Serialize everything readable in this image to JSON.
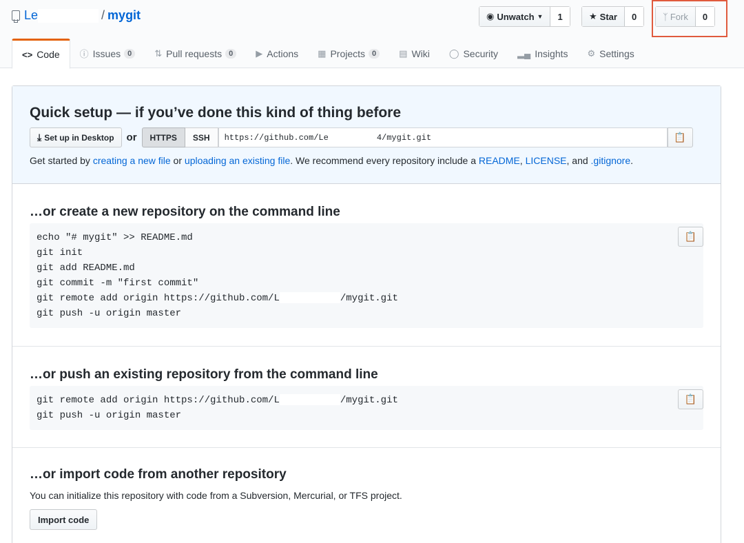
{
  "header": {
    "owner": "Le",
    "slash": "/",
    "repo": "mygit",
    "unwatch": {
      "label": "Unwatch",
      "count": "1"
    },
    "star": {
      "label": "Star",
      "count": "0"
    },
    "fork": {
      "label": "Fork",
      "count": "0"
    }
  },
  "tabs": [
    {
      "label": "Code"
    },
    {
      "label": "Issues",
      "count": "0"
    },
    {
      "label": "Pull requests",
      "count": "0"
    },
    {
      "label": "Actions"
    },
    {
      "label": "Projects",
      "count": "0"
    },
    {
      "label": "Wiki"
    },
    {
      "label": "Security"
    },
    {
      "label": "Insights"
    },
    {
      "label": "Settings"
    }
  ],
  "setup": {
    "title": "Quick setup — if you’ve done this kind of thing before",
    "desktop_btn": "Set up in Desktop",
    "or": "or",
    "https": "HTTPS",
    "ssh": "SSH",
    "url_start": "https://github.com/Le",
    "url_end": "4/mygit.git",
    "help_1": "Get started by ",
    "help_link1": "creating a new file",
    "help_2": " or ",
    "help_link2": "uploading an existing file",
    "help_3": ". We recommend every repository include a ",
    "help_link3": "README",
    "help_4": ", ",
    "help_link4": "LICENSE",
    "help_5": ", and ",
    "help_link5": ".gitignore",
    "help_6": "."
  },
  "create": {
    "title": "…or create a new repository on the command line",
    "lines": [
      "echo \"# mygit\" >> README.md",
      "git init",
      "git add README.md",
      "git commit -m \"first commit\"",
      "git remote add origin https://github.com/L",
      "git push -u origin master"
    ],
    "line5_end": "/mygit.git"
  },
  "push": {
    "title": "…or push an existing repository from the command line",
    "line1": "git remote add origin https://github.com/L",
    "line1_end": "/mygit.git",
    "line2": "git push -u origin master"
  },
  "import": {
    "title": "…or import code from another repository",
    "desc": "You can initialize this repository with code from a Subversion, Mercurial, or TFS project.",
    "button": "Import code"
  }
}
